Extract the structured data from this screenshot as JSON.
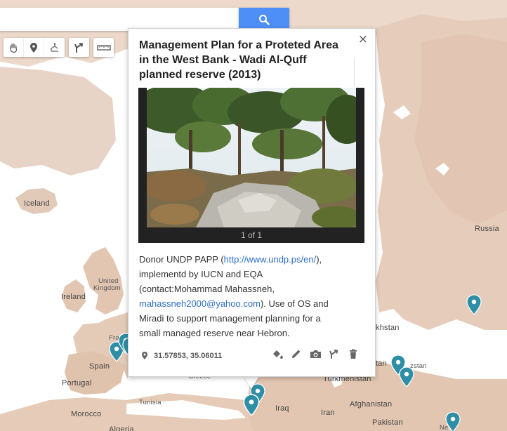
{
  "colors": {
    "water": "#ffffff",
    "land_light": "#f2e5db",
    "land_mid": "#e8d2c3",
    "land_dark": "#dcbfa9",
    "pin": "#2e8ea5",
    "search_button": "#4d8ef7"
  },
  "search": {
    "value": "",
    "placeholder": "",
    "button_icon": "search-icon"
  },
  "toolbar": {
    "tools": [
      {
        "icon": "hand-pan-icon"
      },
      {
        "icon": "marker-icon"
      },
      {
        "icon": "draw-line-icon"
      },
      {
        "icon": "directions-icon"
      },
      {
        "icon": "ruler-icon"
      }
    ]
  },
  "map": {
    "labels": {
      "iceland": "Iceland",
      "russia": "Russia",
      "united_kingdom_1": "United",
      "united_kingdom_2": "Kingdom",
      "ireland": "Ireland",
      "france": "Fra",
      "spain": "Spain",
      "portugal": "Portugal",
      "morocco": "Morocco",
      "algeria": "Algeria",
      "tunisia": "Tunisia",
      "greece": "Greece",
      "iraq": "Iraq",
      "iran": "Iran",
      "afghanistan": "Afghanistan",
      "pakistan": "Pakistan",
      "turkmenistan": "Turkmenistan",
      "kazakhstan": "khstan",
      "uzbekistan": "zstan",
      "tajikistan": "tan",
      "nepal": "Ne"
    },
    "pin_count": 9
  },
  "popup": {
    "title": "Management Plan for a Proteted Area in the West Bank - Wadi Al-Quff planned reserve (2013)",
    "photo_counter": "1 of 1",
    "desc_1": "Donor UNDP PAPP (",
    "link_1": "http://www.undp.ps/en/",
    "desc_2": "), implementd by IUCN and EQA (contact:Mohammad Mahassneh, ",
    "link_2": "mahassneh2000@yahoo.com",
    "desc_3": "). Use of OS and Miradi to support management planning for a small managed reserve near Hebron.",
    "coordinates": "31.57853, 35.06011",
    "actions": [
      "paint-bucket-icon",
      "pencil-icon",
      "camera-icon",
      "directions-icon",
      "trash-icon"
    ]
  }
}
